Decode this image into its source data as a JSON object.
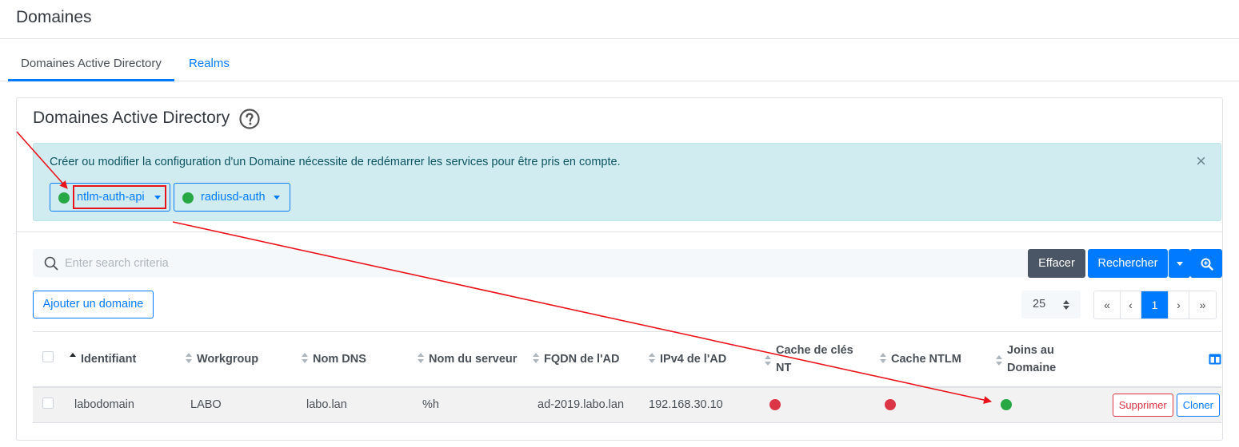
{
  "page": {
    "title": "Domaines"
  },
  "tabs": [
    {
      "label": "Domaines Active Directory",
      "active": true
    },
    {
      "label": "Realms",
      "active": false
    }
  ],
  "card": {
    "title": "Domaines Active Directory",
    "help_icon": "help-circle-icon",
    "alert": {
      "text": "Créer ou modifier la configuration d'un Domaine nécessite de redémarrer les services pour être pris en compte.",
      "close": "×"
    },
    "services": [
      {
        "label": "ntlm-auth-api",
        "status": "running",
        "color": "#28a745"
      },
      {
        "label": "radiusd-auth",
        "status": "running",
        "color": "#28a745"
      }
    ]
  },
  "search": {
    "placeholder": "Enter search criteria",
    "clear_label": "Effacer",
    "search_label": "Rechercher"
  },
  "toolbar": {
    "add_label": "Ajouter un domaine",
    "per_page": "25"
  },
  "pagination": {
    "first": "«",
    "prev": "‹",
    "current": "1",
    "next": "›",
    "last": "»"
  },
  "table": {
    "headers": [
      "Identifiant",
      "Workgroup",
      "Nom DNS",
      "Nom du serveur",
      "FQDN de l'AD",
      "IPv4 de l'AD",
      "Cache de clés NT",
      "Cache NTLM",
      "Joins au Domaine"
    ],
    "rows": [
      {
        "identifiant": "labodomain",
        "workgroup": "LABO",
        "nom_dns": "labo.lan",
        "nom_serveur": "%h",
        "fqdn": "ad-2019.labo.lan",
        "ipv4": "192.168.30.10",
        "cache_nt": "disabled",
        "cache_ntlm": "disabled",
        "joined": "enabled",
        "delete_label": "Supprimer",
        "clone_label": "Cloner"
      }
    ]
  },
  "colors": {
    "accent": "#007bff",
    "ok": "#28a745",
    "danger": "#dc3545",
    "annotation": "#e8131b"
  }
}
